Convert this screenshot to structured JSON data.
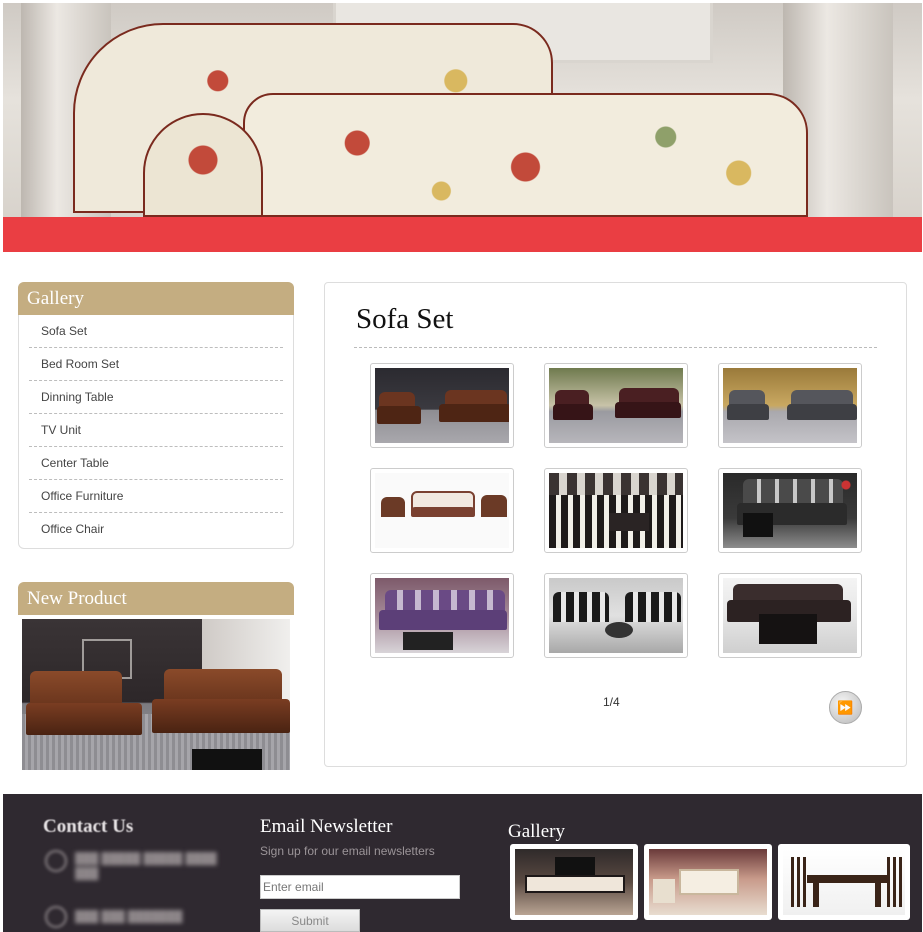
{
  "hero": {
    "image": "floral-chaise-sofa-banner"
  },
  "sidebar": {
    "gallery_title": "Gallery",
    "menu": [
      {
        "label": "Sofa Set"
      },
      {
        "label": "Bed Room Set"
      },
      {
        "label": "Dinning Table"
      },
      {
        "label": "TV Unit"
      },
      {
        "label": "Center Table"
      },
      {
        "label": "Office Furniture"
      },
      {
        "label": "Office Chair"
      }
    ],
    "new_product_title": "New Product"
  },
  "main": {
    "title": "Sofa Set",
    "pager": "1/4",
    "next_icon": "fast-forward-icon"
  },
  "footer": {
    "contact_title": "Contact Us",
    "newsletter_title": "Email Newsletter",
    "newsletter_subtitle": "Sign up for our email newsletters",
    "email_placeholder": "Enter email",
    "submit_label": "Submit",
    "gallery_title": "Gallery"
  },
  "colors": {
    "accent_red": "#ea3e43",
    "header_tan": "#c4ad81",
    "footer_bg": "#2f2930"
  }
}
